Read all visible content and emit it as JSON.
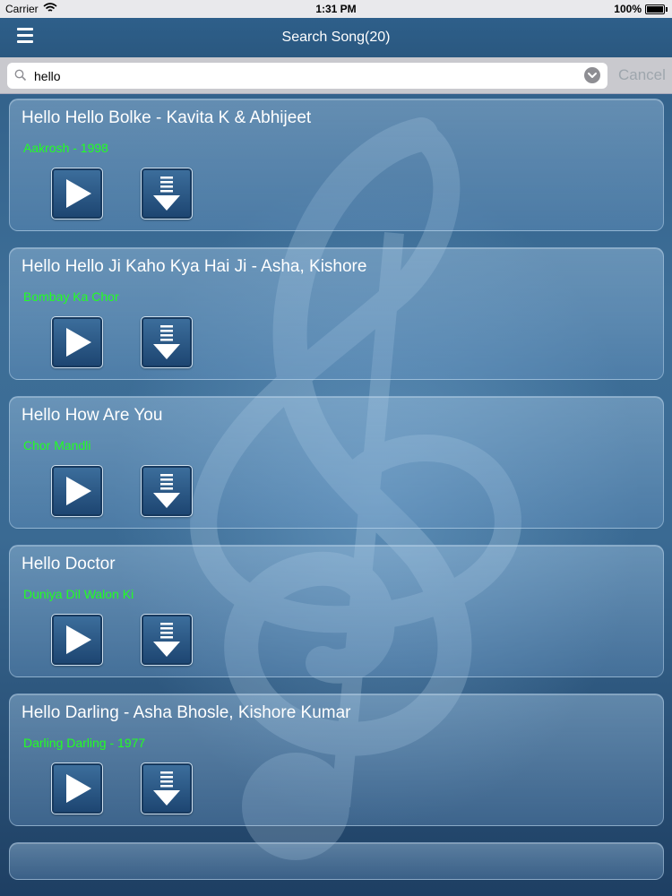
{
  "status_bar": {
    "carrier": "Carrier",
    "time": "1:31 PM",
    "battery": "100%"
  },
  "nav": {
    "title": "Search Song(20)"
  },
  "search": {
    "value": "hello",
    "placeholder": "",
    "cancel_label": "Cancel"
  },
  "colors": {
    "album_text": "#22ff22",
    "nav_bg": "#2e5f8a",
    "search_bar_bg": "#c9c9ce"
  },
  "icons": {
    "menu": "hamburger-icon",
    "search": "magnifier-icon",
    "dropdown": "chevron-down-icon",
    "play": "play-icon",
    "download": "download-icon"
  },
  "songs": [
    {
      "title": "Hello Hello Bolke - Kavita K & Abhijeet",
      "album": "Aakrosh - 1998"
    },
    {
      "title": "Hello Hello Ji Kaho Kya Hai Ji - Asha, Kishore",
      "album": "Bombay Ka Chor"
    },
    {
      "title": "Hello How Are You",
      "album": "Chor Mandli"
    },
    {
      "title": "Hello Doctor",
      "album": "Duniya Dil Walon Ki"
    },
    {
      "title": "Hello Darling - Asha Bhosle, Kishore Kumar",
      "album": "Darling Darling - 1977"
    }
  ]
}
